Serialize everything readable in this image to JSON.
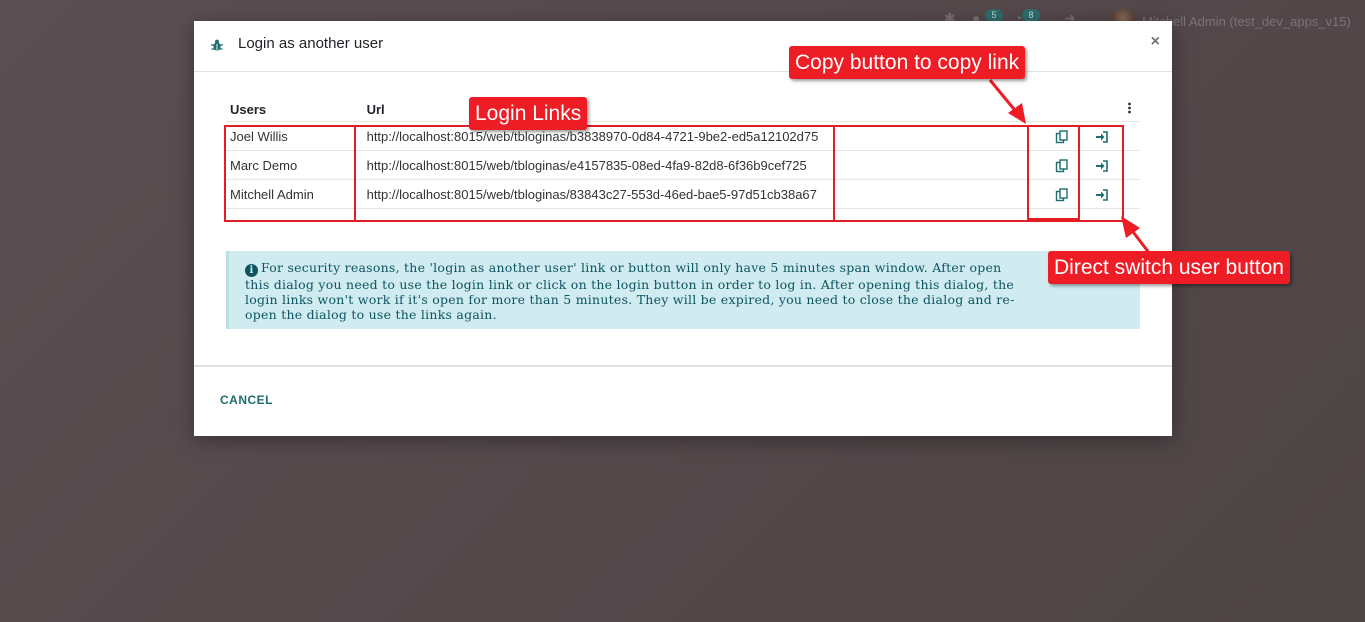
{
  "topbar": {
    "badge_messages": "5",
    "badge_activities": "8",
    "user_label": "Mitchell Admin (test_dev_apps_v15)"
  },
  "dialog": {
    "title": "Login as another user",
    "icon": "bug-icon",
    "columns": {
      "users": "Users",
      "url": "Url"
    },
    "rows": [
      {
        "user": "Joel Willis",
        "url": "http://localhost:8015/web/tbloginas/b3838970-0d84-4721-9be2-ed5a12102d75"
      },
      {
        "user": "Marc Demo",
        "url": "http://localhost:8015/web/tbloginas/e4157835-08ed-4fa9-82d8-6f36b9cef725"
      },
      {
        "user": "Mitchell Admin",
        "url": "http://localhost:8015/web/tbloginas/83843c27-553d-46ed-bae5-97d51cb38a67"
      }
    ],
    "alert_line1": "For security reasons, the 'login as another user' link or button will only have 5 minutes span window. After open",
    "alert_line2": "this dialog you need to use the login link or click on the login button in order to log in. After opening this dialog, the",
    "alert_line3": "login links won't work if it's open for more than 5 minutes. They will be expired, you need to close the dialog and re-",
    "alert_line4": "open the dialog to use the links again.",
    "cancel_label": "CANCEL",
    "close_label": "×"
  },
  "annotations": {
    "login_links": "Login Links",
    "copy_button": "Copy button to copy link",
    "switch_button": "Direct switch user button"
  },
  "colors": {
    "accent": "#1f6d70",
    "annotation_red": "#ee1c25",
    "alert_bg": "#d1ecf1"
  }
}
